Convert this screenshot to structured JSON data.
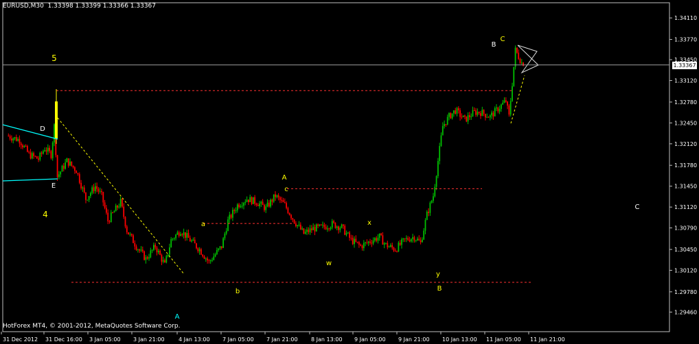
{
  "window": {
    "symbol_info": "EURUSD,M30  1.33398 1.33399 1.33366 1.33367",
    "copyright": "HotForex MT4, © 2001-2012, MetaQuotes Software Corp.",
    "current_price_label": "1.33367"
  },
  "colors": {
    "background": "#000000",
    "bull_candle": "#00c000",
    "bear_candle": "#ff0000",
    "axis": "#c0c0c0",
    "dashed_level": "#ff3030",
    "trend_dashed": "#ffff00",
    "channel_line": "#00ffff",
    "wave_label": "#ffff00",
    "white_label": "#ffffff"
  },
  "chart_data": {
    "type": "candlestick",
    "y_ticks": [
      "1.34110",
      "1.33770",
      "1.33450",
      "1.33120",
      "1.32780",
      "1.32450",
      "1.32120",
      "1.31780",
      "1.31450",
      "1.31120",
      "1.30790",
      "1.30450",
      "1.30120",
      "1.29780",
      "1.29460"
    ],
    "y_tick_values": [
      1.3411,
      1.3377,
      1.3345,
      1.3312,
      1.3278,
      1.3245,
      1.3212,
      1.3178,
      1.3145,
      1.3112,
      1.3079,
      1.3045,
      1.3012,
      1.2978,
      1.2946
    ],
    "ylim": [
      1.2915,
      1.3435
    ],
    "x_ticks": [
      "31 Dec 2012",
      "31 Dec 16:00",
      "3 Jan 05:00",
      "3 Jan 21:00",
      "4 Jan 13:00",
      "7 Jan 05:00",
      "7 Jan 21:00",
      "8 Jan 13:00",
      "9 Jan 05:00",
      "9 Jan 21:00",
      "10 Jan 13:00",
      "11 Jan 05:00",
      "11 Jan 21:00"
    ],
    "bars": 232,
    "close_path": [
      [
        0,
        1.3225
      ],
      [
        8,
        1.3218
      ],
      [
        14,
        1.3195
      ],
      [
        20,
        1.3188
      ],
      [
        24,
        1.3205
      ],
      [
        28,
        1.3195
      ],
      [
        30,
        1.324
      ],
      [
        32,
        1.316
      ],
      [
        38,
        1.3185
      ],
      [
        44,
        1.317
      ],
      [
        50,
        1.3125
      ],
      [
        56,
        1.3145
      ],
      [
        60,
        1.313
      ],
      [
        64,
        1.309
      ],
      [
        72,
        1.312
      ],
      [
        76,
        1.3075
      ],
      [
        82,
        1.305
      ],
      [
        88,
        1.303
      ],
      [
        94,
        1.305
      ],
      [
        100,
        1.302
      ],
      [
        104,
        1.306
      ],
      [
        110,
        1.3075
      ],
      [
        116,
        1.306
      ],
      [
        122,
        1.3045
      ],
      [
        128,
        1.3025
      ],
      [
        136,
        1.305
      ],
      [
        140,
        1.309
      ],
      [
        146,
        1.3115
      ],
      [
        152,
        1.3125
      ],
      [
        158,
        1.312
      ],
      [
        164,
        1.311
      ],
      [
        170,
        1.313
      ],
      [
        176,
        1.3115
      ],
      [
        182,
        1.309
      ],
      [
        188,
        1.307
      ],
      [
        194,
        1.3078
      ],
      [
        200,
        1.308
      ],
      [
        206,
        1.3085
      ],
      [
        212,
        1.308
      ],
      [
        218,
        1.306
      ],
      [
        224,
        1.305
      ],
      [
        230,
        1.3058
      ],
      [
        236,
        1.3065
      ],
      [
        240,
        1.3052
      ],
      [
        246,
        1.3045
      ],
      [
        252,
        1.306
      ],
      [
        258,
        1.3065
      ],
      [
        262,
        1.3055
      ],
      [
        266,
        1.31
      ],
      [
        270,
        1.313
      ],
      [
        276,
        1.324
      ],
      [
        280,
        1.3255
      ],
      [
        284,
        1.3265
      ],
      [
        290,
        1.325
      ],
      [
        296,
        1.3262
      ],
      [
        300,
        1.3262
      ],
      [
        306,
        1.3255
      ],
      [
        310,
        1.3265
      ],
      [
        316,
        1.328
      ],
      [
        318,
        1.3255
      ],
      [
        322,
        1.336
      ],
      [
        326,
        1.334
      ],
      [
        330,
        1.334
      ]
    ],
    "current_price": 1.33367,
    "annotations": [
      {
        "text": "5",
        "color": "yellow"
      },
      {
        "text": "D",
        "color": "white"
      },
      {
        "text": "E",
        "color": "white"
      },
      {
        "text": "4",
        "color": "yellow"
      },
      {
        "text": "a",
        "color": "yellow"
      },
      {
        "text": "b",
        "color": "yellow"
      },
      {
        "text": "A",
        "color": "cyan"
      },
      {
        "text": "A",
        "color": "yellow"
      },
      {
        "text": "c",
        "color": "yellow"
      },
      {
        "text": "w",
        "color": "yellow"
      },
      {
        "text": "x",
        "color": "yellow"
      },
      {
        "text": "y",
        "color": "yellow"
      },
      {
        "text": "B",
        "color": "yellow"
      },
      {
        "text": "B",
        "color": "white"
      },
      {
        "text": "C",
        "color": "yellow"
      },
      {
        "text": "C",
        "color": "white"
      }
    ],
    "horizontal_levels": [
      1.3296,
      1.3141,
      1.3086,
      1.2993
    ]
  }
}
